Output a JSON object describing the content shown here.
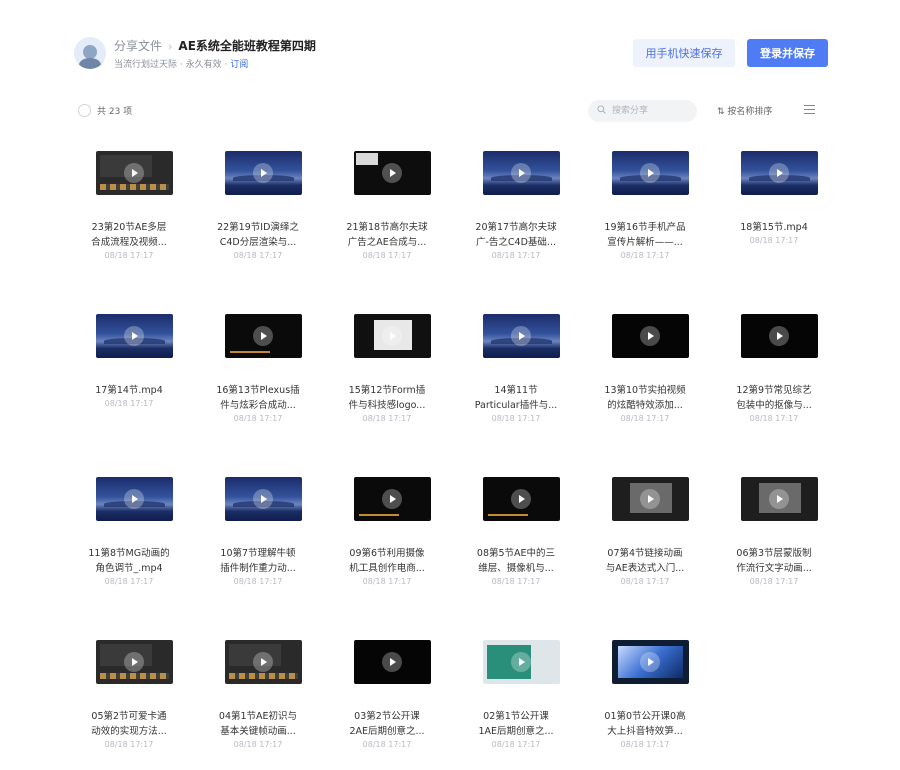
{
  "header": {
    "breadcrumb_root": "分享文件",
    "breadcrumb_sep": "›",
    "folder_name": "AE系统全能班教程第四期",
    "sharer": "当流行划过天际",
    "validity": "永久有效",
    "subscribe": "订阅",
    "dot": "·",
    "phone_save_button": "用手机快速保存",
    "login_save_button": "登录并保存"
  },
  "toolbar": {
    "count": "共 23 项",
    "search_placeholder": "搜索分享",
    "sort_label": "按名称排序"
  },
  "files": [
    {
      "name1": "23第20节AE多层",
      "name2": "合成流程及视频...",
      "date": "08/18 17:17",
      "thumb": "ui"
    },
    {
      "name1": "22第19节ID演绎之",
      "name2": "C4D分层渲染与...",
      "date": "08/18 17:17",
      "thumb": "sky"
    },
    {
      "name1": "21第18节高尔夫球",
      "name2": "广告之AE合成与...",
      "date": "08/18 17:17",
      "thumb": "doc"
    },
    {
      "name1": "20第17节高尔夫球",
      "name2": "广-告之C4D基础...",
      "date": "08/18 17:17",
      "thumb": "sky"
    },
    {
      "name1": "19第16节手机产品",
      "name2": "宣传片解析——...",
      "date": "08/18 17:17",
      "thumb": "sky"
    },
    {
      "name1": "18第15节.mp4",
      "name2": "",
      "date": "08/18 17:17",
      "thumb": "sky"
    },
    {
      "name1": "17第14节.mp4",
      "name2": "",
      "date": "08/18 17:17",
      "thumb": "sky"
    },
    {
      "name1": "16第13节Plexus插",
      "name2": "件与炫彩合成动...",
      "date": "08/18 17:17",
      "thumb": "tl"
    },
    {
      "name1": "15第12节Form插",
      "name2": "件与科技感logo...",
      "date": "08/18 17:17",
      "thumb": "white"
    },
    {
      "name1": "14第11节",
      "name2": "Particular插件与...",
      "date": "08/18 17:17",
      "thumb": "sky"
    },
    {
      "name1": "13第10节实拍视频",
      "name2": "的炫酷特效添加...",
      "date": "08/18 17:17",
      "thumb": "dark"
    },
    {
      "name1": "12第9节常见综艺",
      "name2": "包装中的抠像与...",
      "date": "08/18 17:17",
      "thumb": "dark"
    },
    {
      "name1": "11第8节MG动画的",
      "name2": "角色调节_.mp4",
      "date": "08/18 17:17",
      "thumb": "sky"
    },
    {
      "name1": "10第7节理解牛顿",
      "name2": "插件制作重力动...",
      "date": "08/18 17:17",
      "thumb": "sky"
    },
    {
      "name1": "09第6节利用摄像",
      "name2": "机工具创作电商...",
      "date": "08/18 17:17",
      "thumb": "tl"
    },
    {
      "name1": "08第5节AE中的三",
      "name2": "维层、摄像机与...",
      "date": "08/18 17:17",
      "thumb": "tl"
    },
    {
      "name1": "07第4节链接动画",
      "name2": "与AE表达式入门...",
      "date": "08/18 17:17",
      "thumb": "gray"
    },
    {
      "name1": "06第3节层蒙版制",
      "name2": "作流行文字动画...",
      "date": "08/18 17:17",
      "thumb": "gray"
    },
    {
      "name1": "05第2节可爱卡通",
      "name2": "动效的实现方法...",
      "date": "08/18 17:17",
      "thumb": "ui"
    },
    {
      "name1": "04第1节AE初识与",
      "name2": "基本关键帧动画...",
      "date": "08/18 17:17",
      "thumb": "ui"
    },
    {
      "name1": "03第2节公开课",
      "name2": "2AE后期创意之...",
      "date": "08/18 17:17",
      "thumb": "dark"
    },
    {
      "name1": "02第1节公开课",
      "name2": "1AE后期创意之...",
      "date": "08/18 17:17",
      "thumb": "green"
    },
    {
      "name1": "01第0节公开课0高",
      "name2": "大上抖音特效笋...",
      "date": "08/18 17:17",
      "thumb": "blue"
    }
  ]
}
